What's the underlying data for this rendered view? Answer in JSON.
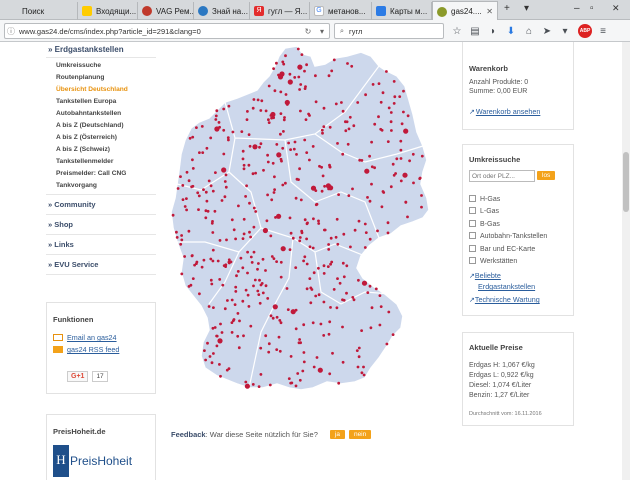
{
  "browser": {
    "tabs": [
      {
        "label": "Поиск",
        "color": "#d6d9dc"
      },
      {
        "label": "Входящи...",
        "color": "#ffcc00"
      },
      {
        "label": "VAG Рем...",
        "color": "#c0392b"
      },
      {
        "label": "Знай на...",
        "color": "#2b78c2"
      },
      {
        "label": "гугл — Я...",
        "color": "#e32c2c"
      },
      {
        "label": "метанов...",
        "color": "#4285f4"
      },
      {
        "label": "Карты м...",
        "color": "#2c7be5"
      },
      {
        "label": "gas24....",
        "color": "#8b9a2a"
      }
    ],
    "url": "www.gas24.de/cms/index.php?article_id=291&clang=0",
    "search_value": "гугл",
    "abp_label": "ABP"
  },
  "sidebar": {
    "section_head": "» Erdgastankstellen",
    "sub_items": [
      "Umkreissuche",
      "Routenplanung",
      "Übersicht Deutschland",
      "Tankstellen Europa",
      "Autobahntankstellen",
      "A bis Z (Deutschland)",
      "A bis Z (Österreich)",
      "A bis Z (Schweiz)",
      "Tankstellenmelder",
      "Preismelder: Call CNG",
      "Tankvorgang"
    ],
    "main_items": [
      "» Community",
      "» Shop",
      "» Links",
      "» EVU Service"
    ],
    "funktionen": {
      "title": "Funktionen",
      "email_link": "Email an gas24",
      "rss_link": "gas24 RSS feed",
      "gplus_label": "G+1",
      "gplus_count": "17"
    },
    "preishoheit": {
      "title": "PreisHoheit.de",
      "logo_letter": "H",
      "logo_text": "PreisHoheit"
    }
  },
  "warenkorb": {
    "title": "Warenkorb",
    "anzahl": "Anzahl Produkte: 0",
    "summe": "Summe: 0,00 EUR",
    "link": "Warenkorb ansehen"
  },
  "umkreis": {
    "title": "Umkreissuche",
    "placeholder": "Ort oder PLZ...",
    "button": "los",
    "options": [
      "H-Gas",
      "L-Gas",
      "B-Gas",
      "Autobahn-Tankstellen",
      "Bar und EC-Karte",
      "Werkstätten"
    ],
    "link1a": "Beliebte",
    "link1b": "Erdgastankstellen",
    "link2": "Technische Wartung"
  },
  "preise": {
    "title": "Aktuelle Preise",
    "lines": [
      "Erdgas H: 1,067 €/kg",
      "Erdgas L: 0,922 €/kg",
      "Diesel: 1,074 €/Liter",
      "Benzin: 1,27 €/Liter"
    ],
    "note": "Durchschnitt vom: 16.11.2016"
  },
  "feedback": {
    "label": "Feedback",
    "question": ": War diese Seite nützlich für Sie?",
    "yes": "ja",
    "no": "nein"
  },
  "colors": {
    "accent": "#f3a21a",
    "nav": "#3b4d6a",
    "dot": "#c0193a",
    "map": "#cdd8ec"
  }
}
